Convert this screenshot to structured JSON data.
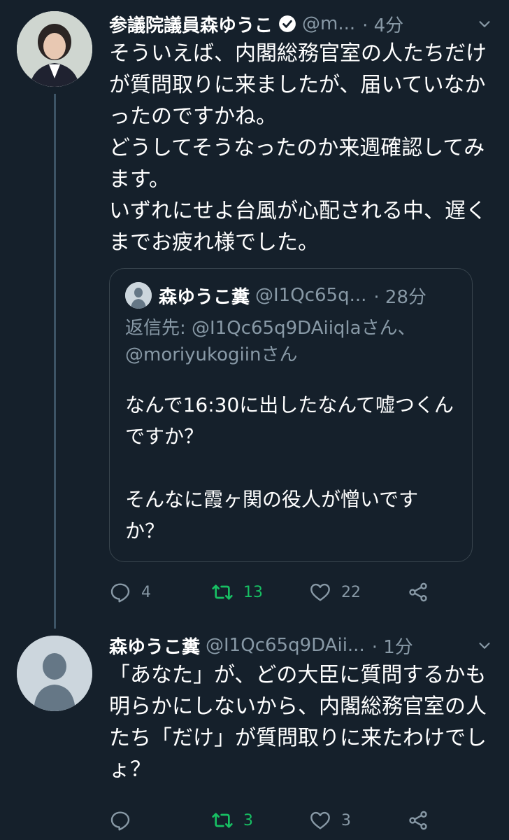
{
  "colors": {
    "background": "#15202b",
    "muted": "#8899a6",
    "retweet_active": "#17bf63",
    "verified": "#ffffff"
  },
  "tweet1": {
    "name": "参議院議員森ゆうこ",
    "handle": "@m...",
    "time": "· 4分",
    "text": "そういえば、内閣総務官室の人たちだけが質問取りに来ましたが、届いていなかったのですかね。\nどうしてそうなったのか来週確認してみます。\nいずれにせよ台風が心配される中、遅くまでお疲れ様でした。",
    "quote": {
      "name": "森ゆうこ糞",
      "handle": "@I1Qc65q...",
      "time": "· 28分",
      "reply_to": "返信先: @I1Qc65q9DAiiqlaさん、\n@moriyukogiinさん",
      "text": "なんで16:30に出したなんて嘘つくんですか？\n\nそんなに霞ヶ関の役人が憎いですか？"
    },
    "replies": "4",
    "retweets": "13",
    "likes": "22"
  },
  "tweet2": {
    "name": "森ゆうこ糞",
    "handle": "@I1Qc65q9DAii...",
    "time": "· 1分",
    "text": "「あなた」が、どの大臣に質問するかも明らかにしないから、内閣総務官室の人たち「だけ」が質問取りに来たわけでしょ？",
    "replies": "",
    "retweets": "3",
    "likes": "3"
  }
}
